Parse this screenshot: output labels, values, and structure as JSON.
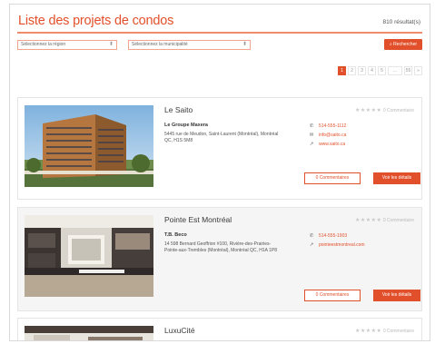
{
  "page": {
    "title": "Liste des projets de condos",
    "result_count": "810 résultat(s)",
    "search_label": "Rechercher",
    "region_select": "Sélectionnez la région",
    "municipality_select": "Sélectionnez la municipalité"
  },
  "pagination": [
    "1",
    "2",
    "3",
    "4",
    "5",
    "...",
    "55",
    "»"
  ],
  "listings": [
    {
      "name": "Le Saito",
      "comments": "0 Commentaire",
      "company": "Le Groupe Maxera",
      "address": "5445 rue de Meudon, Saint-Laurent (Montréal), Montréal QC, H1S 5M8",
      "phone": "514-555-1112",
      "email": "info@saito.ca",
      "website": "www.saito.ca",
      "comment_btn": "0 Commentaires",
      "details_btn": "Voir les détails"
    },
    {
      "name": "Pointe Est Montréal",
      "comments": "0 Commentaire",
      "company": "T.B. Beco",
      "address": "14 598 Bernard Geoffrion #100, Rivière-des-Prairies-Pointe-aux-Trembles (Montréal), Montréal QC, H1A 1P8",
      "phone": "514-555-1903",
      "website": "pointeestmontreal.com",
      "comment_btn": "0 Commentaires",
      "details_btn": "Voir les détails"
    },
    {
      "name": "LuxuCité",
      "comments": "0 Commentaire"
    }
  ]
}
